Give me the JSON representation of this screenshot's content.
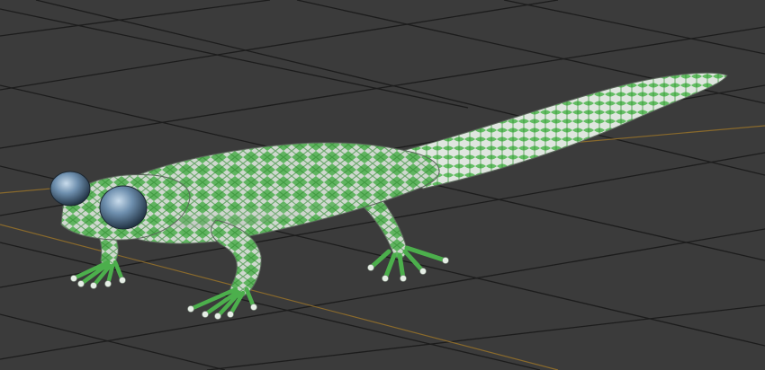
{
  "viewport": {
    "background_color": "#3b3b3b",
    "grid_line_color": "#1c1c1c",
    "axis_line_color": "#8a6a2c"
  },
  "model": {
    "subject": "lizard",
    "skin_colors": [
      "#4cae4c",
      "#d9e0d9",
      "#8fcf8f"
    ],
    "eye_color": "#5d7f9c"
  }
}
